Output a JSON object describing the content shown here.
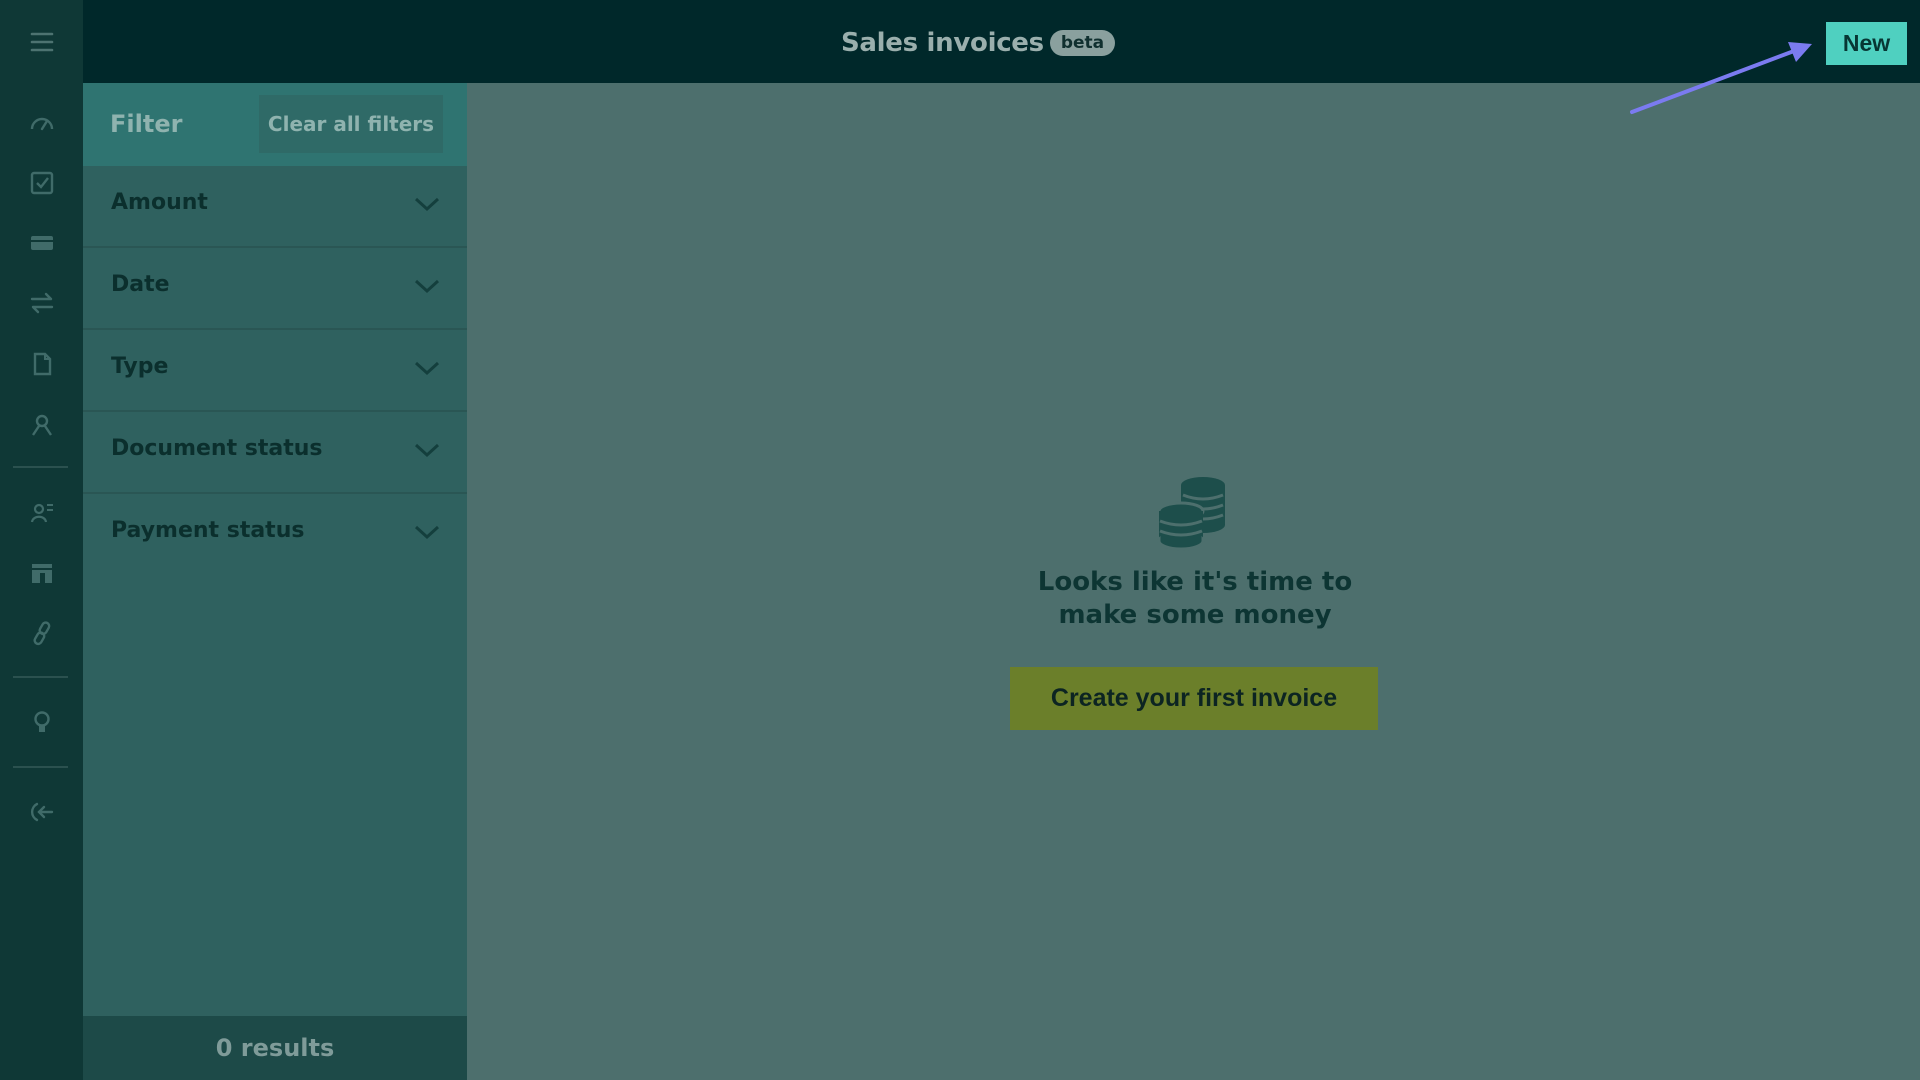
{
  "topbar": {
    "title": "Sales invoices",
    "badge": "beta",
    "new_button": "New"
  },
  "filter": {
    "title": "Filter",
    "clear_label": "Clear all filters",
    "items": [
      {
        "label": "Amount"
      },
      {
        "label": "Date"
      },
      {
        "label": "Type"
      },
      {
        "label": "Document status"
      },
      {
        "label": "Payment status"
      }
    ],
    "results": "0 results"
  },
  "empty_state": {
    "message": "Looks like it's time to make some money",
    "cta": "Create your first invoice"
  },
  "rail_icons": [
    "menu-icon",
    "dashboard-icon",
    "tasks-icon",
    "card-icon",
    "transfer-icon",
    "document-icon",
    "contacts-icon",
    "user-list-icon",
    "store-icon",
    "link-icon",
    "lightbulb-icon",
    "logout-icon"
  ],
  "colors": {
    "accent": "#4fd0c0",
    "cta": "#6b7f2a",
    "annotation_arrow": "#7b7bf0"
  }
}
